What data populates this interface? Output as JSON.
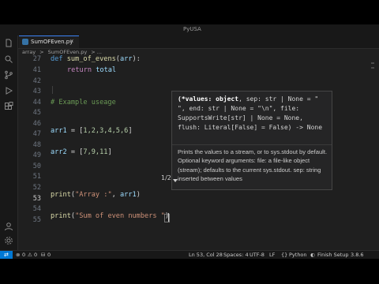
{
  "window": {
    "title": "PyUSA"
  },
  "tab": {
    "filename": "SumOFEven.py",
    "close_glyph": "×"
  },
  "breadcrumb": {
    "folder": "array",
    "separator": ">",
    "file": "SumOFEven.py",
    "ellipsis": "> ..."
  },
  "line_numbers": [
    "27",
    "41",
    "42",
    "43",
    "44",
    "45",
    "46",
    "47",
    "48",
    "49",
    "50",
    "51",
    "52",
    "53",
    "54",
    "55"
  ],
  "current_line": "53",
  "code": {
    "l27_def": "def ",
    "l27_name": "sum_of_evens",
    "l27_paren_open": "(",
    "l27_param": "arr",
    "l27_rest": "):",
    "l41_return": "return ",
    "l41_var": "total",
    "l44_comment": "# Example useage",
    "l46_var": "arr1",
    "l46_eq": " = [",
    "l46_vals": "1,2,3,4,5,6",
    "l46_close": "]",
    "l48_var": "arr2",
    "l48_eq": " = [",
    "l48_vals": "7,9,11",
    "l48_close": "]",
    "l51_fn": "print",
    "l51_open": "(",
    "l51_str": "\"Array :\"",
    "l51_comma": ", ",
    "l51_arg": "arr1",
    "l51_close": ")",
    "l53_fn": "print",
    "l53_open": "(",
    "l53_str": "\"Sum of even numbers \"",
    "l53_close": ")"
  },
  "tooltip": {
    "signature_bold": "(*values: object",
    "signature_rest": ", sep: str | None = \" \", end: str | None = \"\\n\", file: SupportsWrite[str] | None = None, flush: Literal[False] = False) -> None",
    "doc": "Prints the values to a stream, or to sys.stdout by default. Optional keyword arguments: file: a file-like object (stream); defaults to the current sys.stdout. sep: string inserted between values",
    "pager": "1/2"
  },
  "status": {
    "errors": "0",
    "warnings": "0",
    "ports": "0",
    "position": "Ln 53, Col 28",
    "spaces": "Spaces: 4",
    "encoding": "UTF-8",
    "eol": "LF",
    "language": "Python",
    "finish_setup": "Finish Setup",
    "python_version": "3.8.6"
  },
  "colors": {
    "accent": "#0078d4",
    "background": "#1f1f1f",
    "tooltip_bg": "#252526"
  },
  "icons": [
    "files-icon",
    "search-icon",
    "source-control-icon",
    "run-debug-icon",
    "extensions-icon",
    "account-icon",
    "settings-icon"
  ]
}
